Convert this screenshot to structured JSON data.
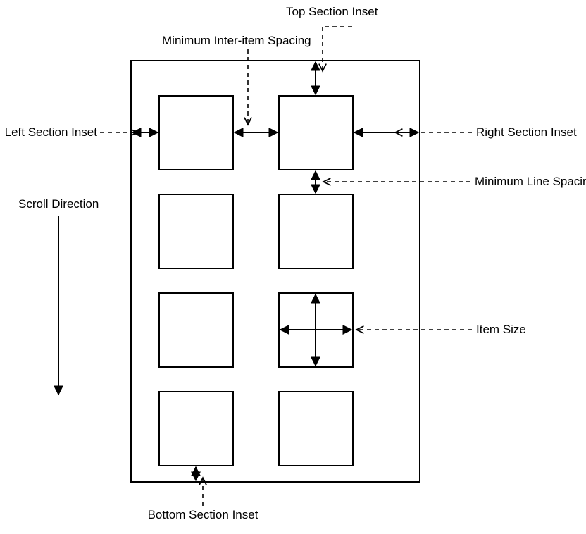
{
  "labels": {
    "top_section_inset": "Top Section Inset",
    "min_inter_item_spacing": "Minimum Inter-item Spacing",
    "left_section_inset": "Left Section Inset",
    "right_section_inset": "Right Section Inset",
    "min_line_spacing": "Minimum Line Spacing",
    "scroll_direction": "Scroll Direction",
    "item_size": "Item Size",
    "bottom_section_inset": "Bottom Section Inset"
  },
  "diagram": {
    "grid_rows": 4,
    "grid_cols": 2
  }
}
